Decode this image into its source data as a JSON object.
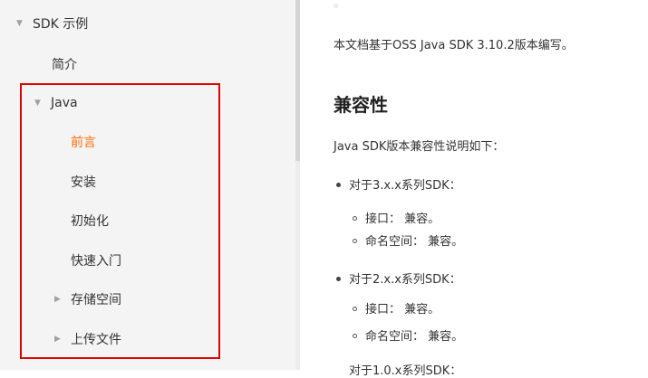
{
  "sidebar": {
    "root": "SDK 示例",
    "intro": "简介",
    "java": "Java",
    "items": {
      "preface": "前言",
      "install": "安装",
      "init": "初始化",
      "quickstart": "快速入门",
      "storage": "存储空间",
      "upload": "上传文件"
    }
  },
  "content": {
    "intro_line": "本文档基于OSS Java SDK 3.10.2版本编写。",
    "heading": "兼容性",
    "desc": "Java SDK版本兼容性说明如下：",
    "groups": [
      {
        "title": "对于3.x.x系列SDK：",
        "interface": "接口： 兼容。",
        "namespace": "命名空间： 兼容。"
      },
      {
        "title": "对于2.x.x系列SDK：",
        "interface": "接口： 兼容。",
        "namespace": "命名空间： 兼容。"
      }
    ],
    "cutoff": "对于1.0.x系列SDK："
  },
  "colors": {
    "active": "#ff6a00",
    "highlight_border": "#e00000",
    "sidebar_bg": "#f4f4f4"
  }
}
